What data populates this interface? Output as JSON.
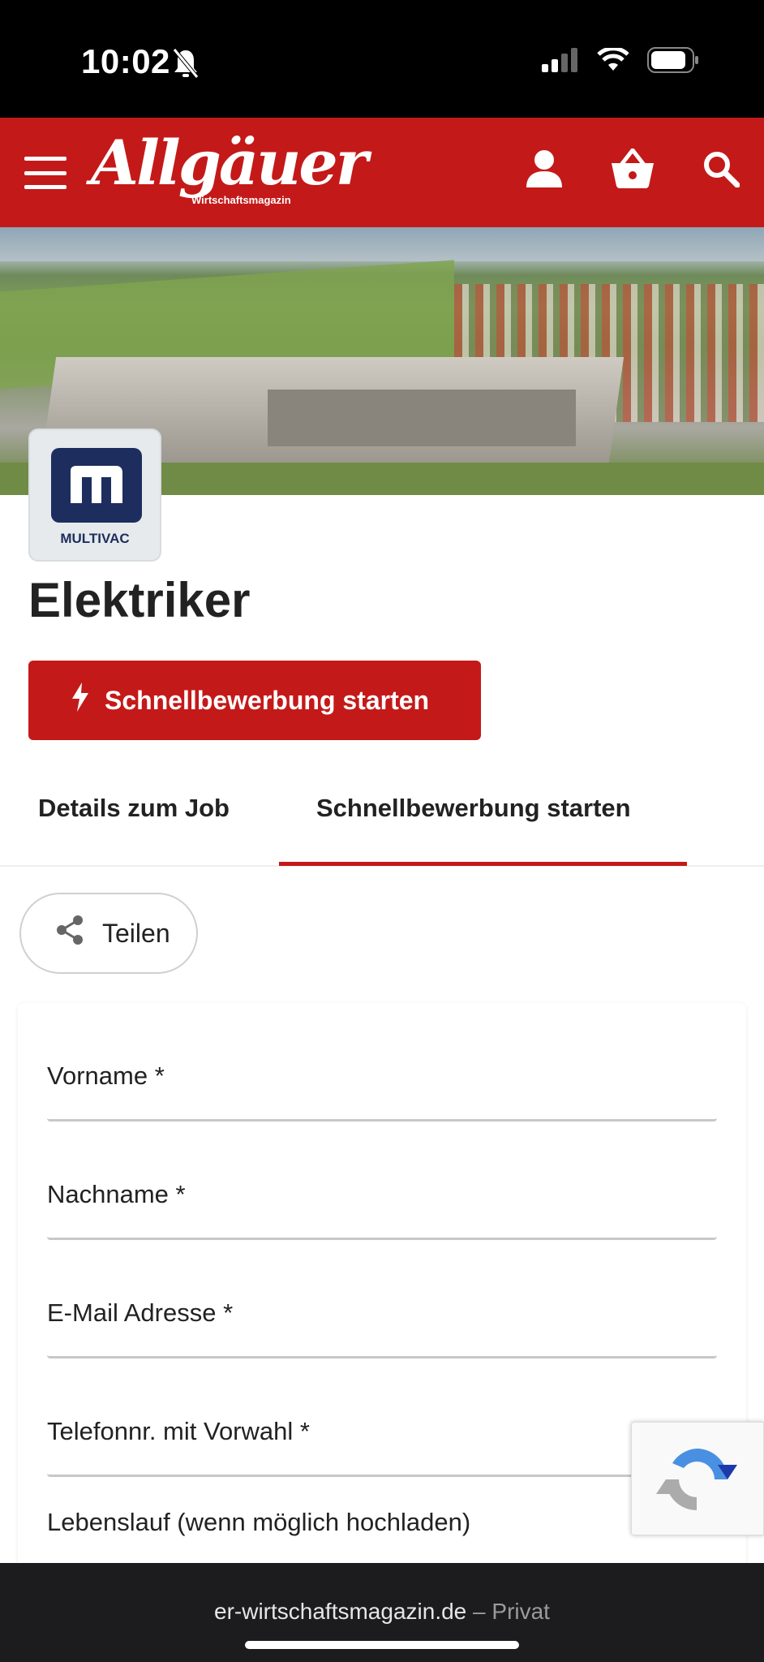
{
  "status_bar": {
    "time": "10:02"
  },
  "header": {
    "logo_main": "Allgäuer",
    "logo_sub": "Wirtschaftsmagazin",
    "brand_color": "#c41919"
  },
  "company": {
    "name": "MULTIVAC"
  },
  "job": {
    "title": "Elektriker"
  },
  "actions": {
    "quick_apply_label": "Schnellbewerbung starten"
  },
  "tabs": [
    {
      "label": "Details zum Job",
      "active": false
    },
    {
      "label": "Schnellbewerbung starten",
      "active": true
    }
  ],
  "share": {
    "label": "Teilen"
  },
  "form": {
    "fields": [
      {
        "label": "Vorname *",
        "value": ""
      },
      {
        "label": "Nachname *",
        "value": ""
      },
      {
        "label": "E-Mail Adresse  *",
        "value": ""
      },
      {
        "label": "Telefonnr. mit Vorwahl *",
        "value": ""
      }
    ],
    "cv_label": "Lebenslauf (wenn möglich hochladen)"
  },
  "browser": {
    "url": "er-wirtschaftsmagazin.de",
    "separator": " – ",
    "mode": "Privat"
  }
}
